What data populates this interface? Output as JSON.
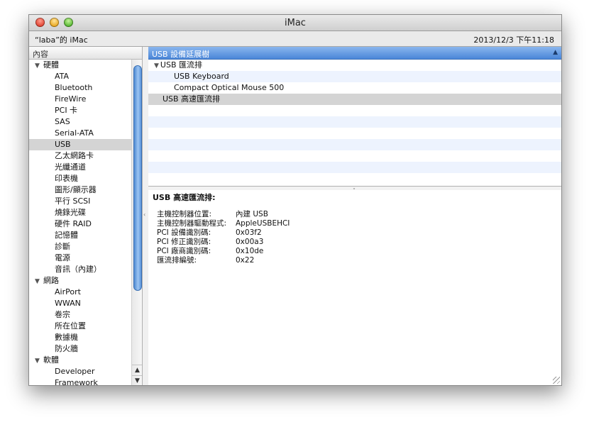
{
  "window": {
    "title": "iMac"
  },
  "infobar": {
    "computer_name": "“laba”的 iMac",
    "datetime": "2013/12/3 下午11:18"
  },
  "sidebar": {
    "header": "內容",
    "rows": [
      {
        "label": "硬體",
        "type": "cat"
      },
      {
        "label": "ATA",
        "type": "leaf"
      },
      {
        "label": "Bluetooth",
        "type": "leaf"
      },
      {
        "label": "FireWire",
        "type": "leaf"
      },
      {
        "label": "PCI 卡",
        "type": "leaf"
      },
      {
        "label": "SAS",
        "type": "leaf"
      },
      {
        "label": "Serial-ATA",
        "type": "leaf"
      },
      {
        "label": "USB",
        "type": "leaf",
        "selected": true
      },
      {
        "label": "乙太網路卡",
        "type": "leaf"
      },
      {
        "label": "光纖通道",
        "type": "leaf"
      },
      {
        "label": "印表機",
        "type": "leaf"
      },
      {
        "label": "圖形/顯示器",
        "type": "leaf"
      },
      {
        "label": "平行 SCSI",
        "type": "leaf"
      },
      {
        "label": "燒錄光碟",
        "type": "leaf"
      },
      {
        "label": "硬件 RAID",
        "type": "leaf"
      },
      {
        "label": "記憶體",
        "type": "leaf"
      },
      {
        "label": "診斷",
        "type": "leaf"
      },
      {
        "label": "電源",
        "type": "leaf"
      },
      {
        "label": "音訊（內建）",
        "type": "leaf"
      },
      {
        "label": "網路",
        "type": "cat"
      },
      {
        "label": "AirPort",
        "type": "leaf"
      },
      {
        "label": "WWAN",
        "type": "leaf"
      },
      {
        "label": "卷宗",
        "type": "leaf"
      },
      {
        "label": "所在位置",
        "type": "leaf"
      },
      {
        "label": "數據機",
        "type": "leaf"
      },
      {
        "label": "防火牆",
        "type": "leaf"
      },
      {
        "label": "軟體",
        "type": "cat"
      },
      {
        "label": "Developer",
        "type": "leaf"
      },
      {
        "label": "Framework",
        "type": "leaf"
      }
    ]
  },
  "upper": {
    "header": "USB 設備延展樹",
    "rows": [
      {
        "label": "USB 匯流排",
        "indent": 1,
        "disclosure": "▼"
      },
      {
        "label": "USB Keyboard",
        "indent": 3
      },
      {
        "label": "Compact Optical Mouse 500",
        "indent": 3
      },
      {
        "label": "USB 高速匯流排",
        "indent": 2,
        "selected": true
      },
      {
        "label": "",
        "indent": 0
      },
      {
        "label": "",
        "indent": 0
      },
      {
        "label": "",
        "indent": 0
      },
      {
        "label": "",
        "indent": 0
      },
      {
        "label": "",
        "indent": 0
      },
      {
        "label": "",
        "indent": 0
      }
    ]
  },
  "detail": {
    "title": "USB 高速匯流排:",
    "items": [
      {
        "key": "主機控制器位置:",
        "value": "內建 USB"
      },
      {
        "key": "主機控制器驅動程式:",
        "value": "AppleUSBEHCI"
      },
      {
        "key": "PCI 設備識別碼:",
        "value": "0x03f2"
      },
      {
        "key": "PCI 修正識別碼:",
        "value": "0x00a3"
      },
      {
        "key": "PCI 廠商識別碼:",
        "value": "0x10de"
      },
      {
        "key": "匯流排編號:",
        "value": "0x22"
      }
    ]
  },
  "icons": {
    "disclosure_open": "▼",
    "sort": "▲",
    "scroll_up": "▲",
    "scroll_down": "▼"
  }
}
